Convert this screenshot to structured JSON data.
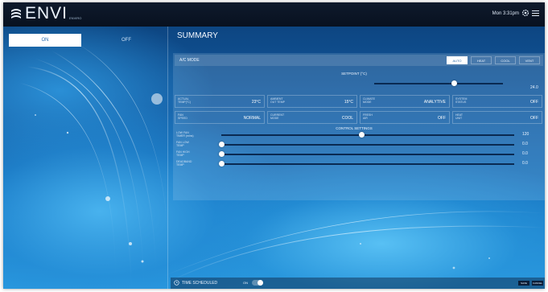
{
  "app": {
    "logo_text": "ENVI",
    "logo_sub": "ENVIRO",
    "datetime": "Mon 3:31pm"
  },
  "tabs": {
    "on": "ON",
    "off": "OFF"
  },
  "summary": {
    "title": "SUMMARY"
  },
  "mode": {
    "label": "A/C MODE",
    "buttons": [
      "AUTO",
      "HEAT",
      "COOL",
      "VENT"
    ],
    "active_index": 0
  },
  "setpoint": {
    "title": "SETPOINT (°C)",
    "value": "24.0",
    "fraction": 0.62
  },
  "status_row1": [
    {
      "label": "ACTUAL\nTEMP(°C)",
      "value": "23°C"
    },
    {
      "label": "AMBIENT\nOUT TEMP",
      "value": "15°C"
    },
    {
      "label": "CLIMATE\nMODE",
      "value": "ANALYTIVE"
    },
    {
      "label": "SYSTEM\nSTATUS",
      "value": "OFF"
    }
  ],
  "status_row2": [
    {
      "label": "FAN\nSPEED",
      "value": "NORMAL"
    },
    {
      "label": "CURRENT\nMODE",
      "value": "COOL"
    },
    {
      "label": "FRESH\nAIR",
      "value": "OFF"
    },
    {
      "label": "HEAT\nUNIT",
      "value": "OFF"
    }
  ],
  "controls": {
    "title": "CONTROL SETTINGS",
    "sliders": [
      {
        "label": "LOW FAN\nTIMER (mins)",
        "value": "120",
        "fraction": 0.48
      },
      {
        "label": "FAN LOW\nTEMP",
        "value": "0.0",
        "fraction": 0.0
      },
      {
        "label": "FAN HIGH\nTEMP",
        "value": "0.0",
        "fraction": 0.0
      },
      {
        "label": "DEADBAND\nTEMP",
        "value": "0.0",
        "fraction": 0.0
      }
    ]
  },
  "bottom": {
    "schedule_label": "TIME SCHEDULED",
    "schedule_switch": "ON",
    "buttons": [
      "SAVE",
      "CANCEL"
    ]
  },
  "colors": {
    "track": "#0a2a52",
    "accent": "#ffffff",
    "background": "#135aa0"
  }
}
